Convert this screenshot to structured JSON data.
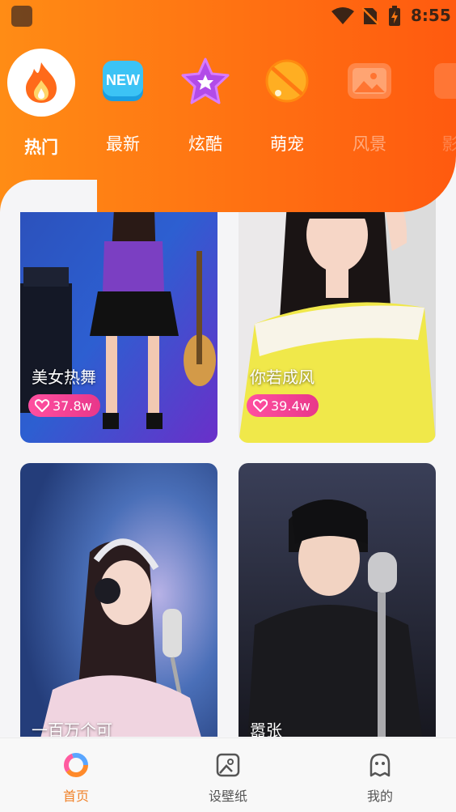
{
  "status": {
    "time": "8:55"
  },
  "categories": [
    {
      "label": "热门",
      "icon": "flame-icon",
      "active": true
    },
    {
      "label": "最新",
      "icon": "new-badge-icon"
    },
    {
      "label": "炫酷",
      "icon": "star-icon"
    },
    {
      "label": "萌宠",
      "icon": "pet-icon"
    },
    {
      "label": "风景",
      "icon": "landscape-icon"
    },
    {
      "label": "影",
      "icon": "film-icon"
    }
  ],
  "cards": [
    {
      "title": "美女热舞",
      "likes": "37.8w"
    },
    {
      "title": "你若成风",
      "likes": "39.4w"
    },
    {
      "title": "一百万个可"
    },
    {
      "title": "嚣张"
    }
  ],
  "nav": [
    {
      "label": "首页",
      "icon": "home-ring-icon",
      "active": true
    },
    {
      "label": "设壁纸",
      "icon": "wallpaper-icon"
    },
    {
      "label": "我的",
      "icon": "profile-icon"
    }
  ],
  "colors": {
    "accent": "#ff7a12",
    "like_badge": "#e8378a",
    "nav_active": "#f0822a"
  }
}
